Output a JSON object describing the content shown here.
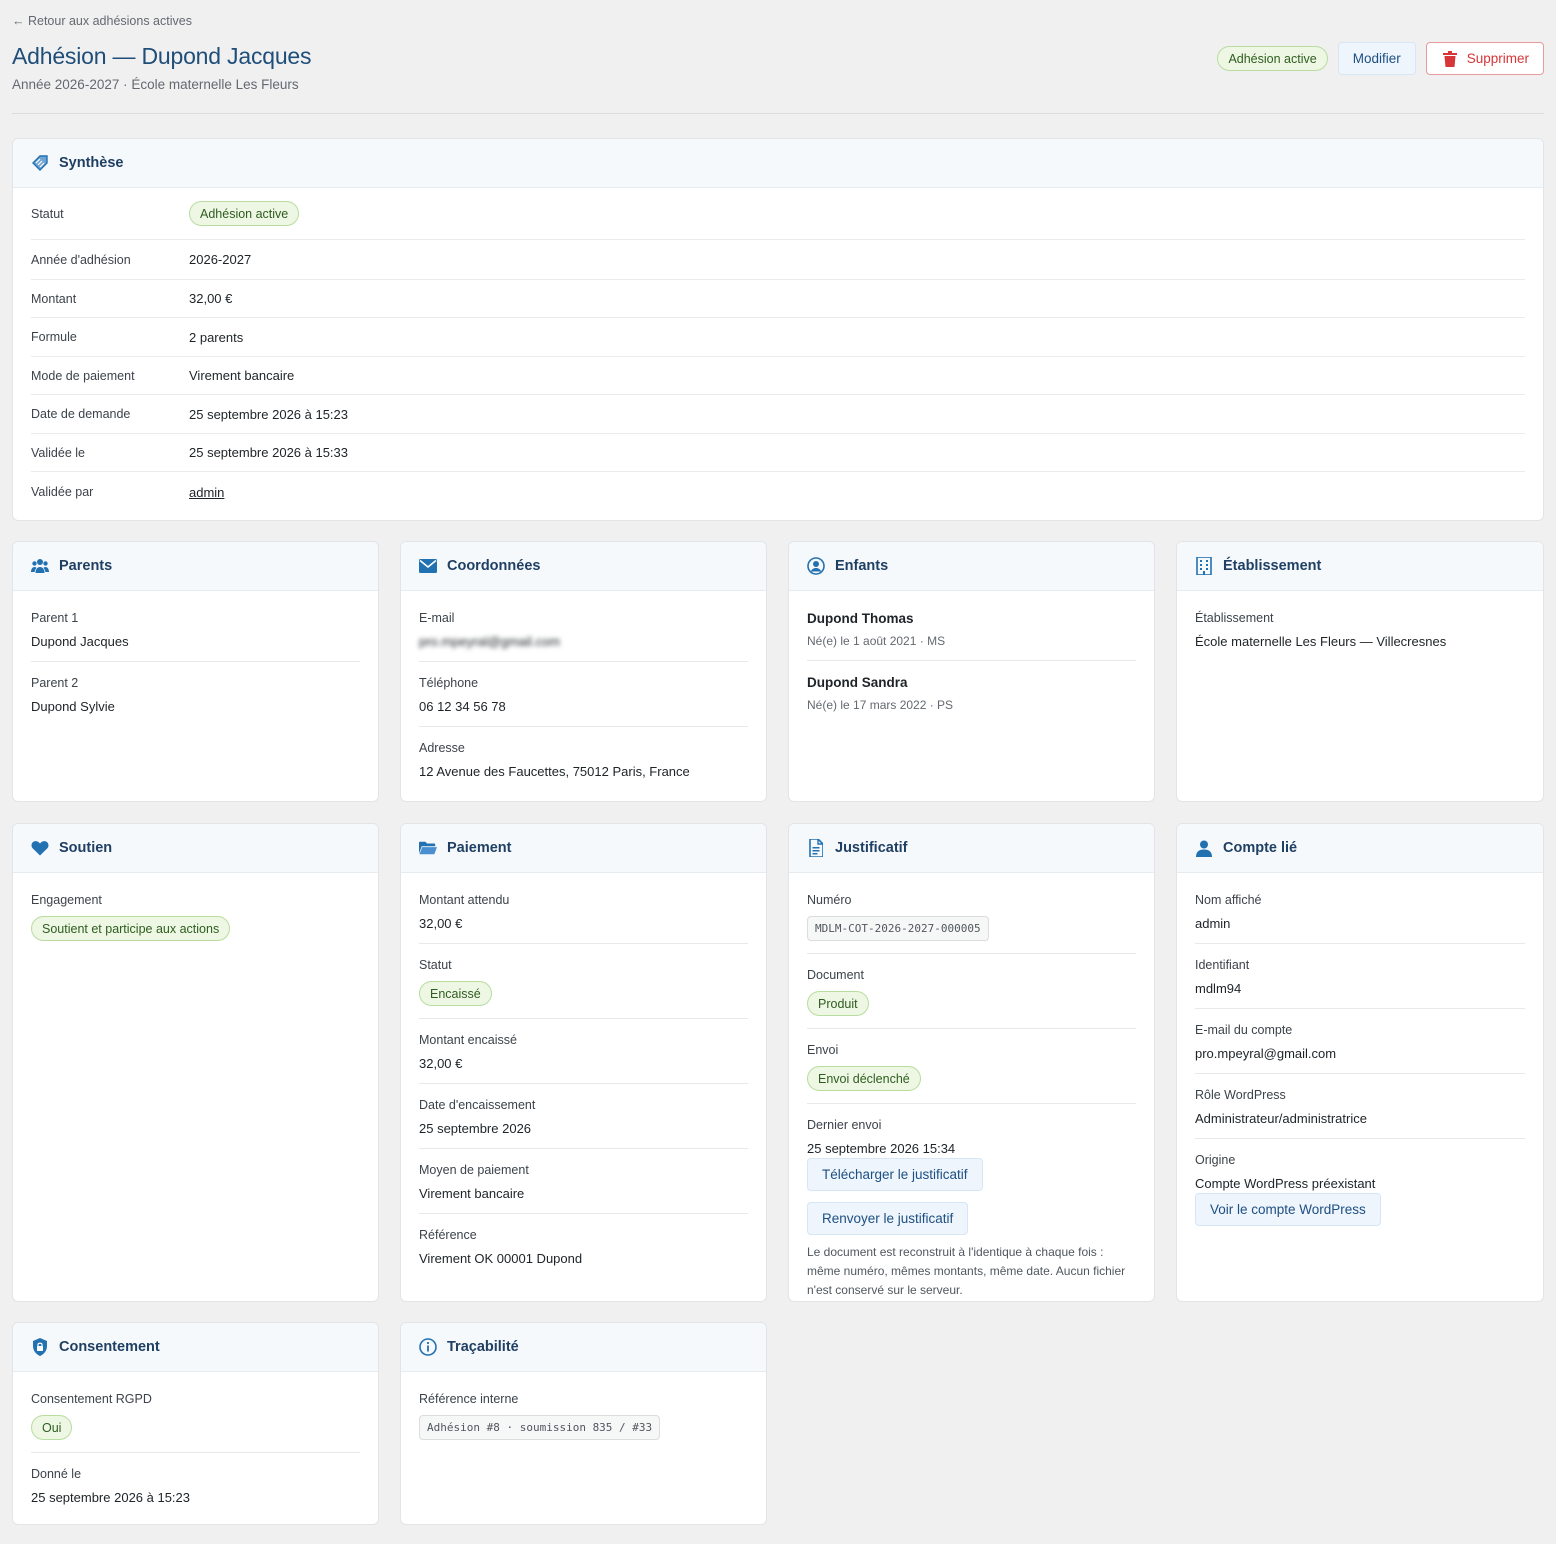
{
  "header": {
    "back_link": "← Retour aux adhésions actives",
    "title": "Adhésion — Dupond Jacques",
    "subtitle": "Année 2026-2027 · École maternelle Les Fleurs",
    "status_badge": "Adhésion active",
    "edit_label": "Modifier",
    "delete_label": "Supprimer"
  },
  "synthese": {
    "title": "Synthèse",
    "rows": [
      {
        "label": "Statut",
        "value": "Adhésion active"
      },
      {
        "label": "Année d'adhésion",
        "value": "2026-2027"
      },
      {
        "label": "Montant",
        "value": "32,00 €"
      },
      {
        "label": "Formule",
        "value": "2 parents"
      },
      {
        "label": "Mode de paiement",
        "value": "Virement bancaire"
      },
      {
        "label": "Date de demande",
        "value": "25 septembre 2026 à 15:23"
      },
      {
        "label": "Validée le",
        "value": "25 septembre 2026 à 15:33"
      },
      {
        "label": "Validée par",
        "value": "admin"
      }
    ]
  },
  "parents": {
    "title": "Parents",
    "fields": [
      {
        "label": "Parent 1",
        "value": "Dupond Jacques"
      },
      {
        "label": "Parent 2",
        "value": "Dupond Sylvie"
      }
    ]
  },
  "coordonnees": {
    "title": "Coordonnées",
    "fields": [
      {
        "label": "E-mail",
        "value": "pro.mpeyral@gmail.com"
      },
      {
        "label": "Téléphone",
        "value": "06 12 34 56 78"
      },
      {
        "label": "Adresse",
        "value": "12 Avenue des Faucettes, 75012 Paris, France"
      }
    ]
  },
  "enfants": {
    "title": "Enfants",
    "children": [
      {
        "name": "Dupond Thomas",
        "meta": "Né(e) le 1 août 2021 · MS"
      },
      {
        "name": "Dupond Sandra",
        "meta": "Né(e) le 17 mars 2022 · PS"
      }
    ]
  },
  "etablissement": {
    "title": "Établissement",
    "fields": [
      {
        "label": "Établissement",
        "value": "École maternelle Les Fleurs — Villecresnes"
      }
    ]
  },
  "soutien": {
    "title": "Soutien",
    "fields": [
      {
        "label": "Engagement",
        "value": "Soutient et participe aux actions"
      }
    ]
  },
  "paiement": {
    "title": "Paiement",
    "fields": [
      {
        "label": "Montant attendu",
        "value": "32,00 €"
      },
      {
        "label": "Statut",
        "value": "Encaissé"
      },
      {
        "label": "Montant encaissé",
        "value": "32,00 €"
      },
      {
        "label": "Date d'encaissement",
        "value": "25 septembre 2026"
      },
      {
        "label": "Moyen de paiement",
        "value": "Virement bancaire"
      },
      {
        "label": "Référence",
        "value": "Virement OK 00001 Dupond"
      }
    ]
  },
  "justificatif": {
    "title": "Justificatif",
    "fields": [
      {
        "label": "Numéro",
        "value": "MDLM-COT-2026-2027-000005"
      },
      {
        "label": "Document",
        "value": "Produit"
      },
      {
        "label": "Envoi",
        "value": "Envoi déclenché"
      },
      {
        "label": "Dernier envoi",
        "value": "25 septembre 2026 15:34"
      }
    ],
    "download_label": "Télécharger le justificatif",
    "resend_label": "Renvoyer le justificatif",
    "note": "Le document est reconstruit à l'identique à chaque fois : même numéro, mêmes montants, même date. Aucun fichier n'est conservé sur le serveur."
  },
  "compte": {
    "title": "Compte lié",
    "fields": [
      {
        "label": "Nom affiché",
        "value": "admin"
      },
      {
        "label": "Identifiant",
        "value": "mdlm94"
      },
      {
        "label": "E-mail du compte",
        "value": "pro.mpeyral@gmail.com"
      },
      {
        "label": "Rôle WordPress",
        "value": "Administrateur/administratrice"
      },
      {
        "label": "Origine",
        "value": "Compte WordPress préexistant"
      }
    ],
    "view_label": "Voir le compte WordPress"
  },
  "consentement": {
    "title": "Consentement",
    "fields": [
      {
        "label": "Consentement RGPD",
        "value": "Oui"
      },
      {
        "label": "Donné le",
        "value": "25 septembre 2026 à 15:23"
      }
    ]
  },
  "tracabilite": {
    "title": "Traçabilité",
    "fields": [
      {
        "label": "Référence interne",
        "value": "Adhésion #8 · soumission 835 / #33"
      }
    ]
  },
  "colors": {
    "accent": "#2271b1",
    "title": "#1f4e79",
    "success_bg": "#edf7e4",
    "danger": "#d63638"
  },
  "icons": {
    "synthese": "tag-icon",
    "parents": "group-icon",
    "coordonnees": "envelope-icon",
    "enfants": "user-circle-icon",
    "etablissement": "building-icon",
    "soutien": "heart-icon",
    "paiement": "folder-icon",
    "justificatif": "document-icon",
    "compte": "user-icon",
    "consentement": "shield-lock-icon",
    "tracabilite": "info-icon",
    "delete": "trash-icon"
  }
}
